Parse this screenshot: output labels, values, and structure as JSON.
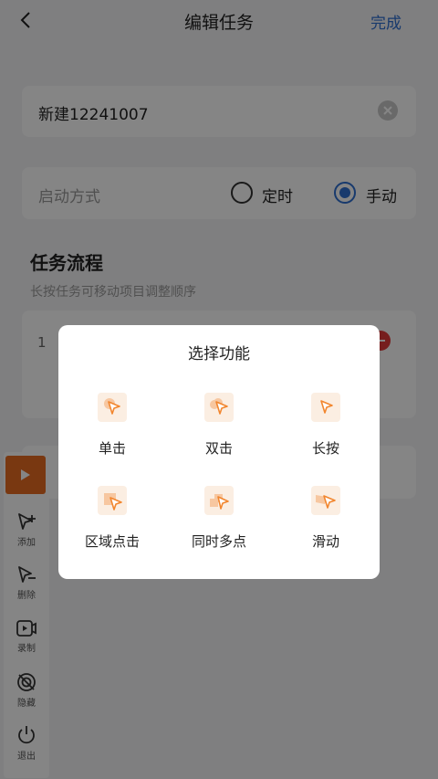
{
  "header": {
    "title": "编辑任务",
    "done_label": "完成"
  },
  "task_name": {
    "value": "新建12241007"
  },
  "start_mode": {
    "label": "启动方式",
    "options": [
      {
        "label": "定时",
        "selected": false
      },
      {
        "label": "手动",
        "selected": true
      }
    ]
  },
  "flow": {
    "title": "任务流程",
    "hint": "长按任务可移动项目调整顺序",
    "items": [
      {
        "index": "1"
      }
    ]
  },
  "toolbar": {
    "items": [
      {
        "label": "添加",
        "icon": "cursor-plus-icon"
      },
      {
        "label": "删除",
        "icon": "cursor-minus-icon"
      },
      {
        "label": "录制",
        "icon": "video-record-icon"
      },
      {
        "label": "隐藏",
        "icon": "eye-hide-icon"
      },
      {
        "label": "退出",
        "icon": "power-icon"
      }
    ]
  },
  "dialog": {
    "title": "选择功能",
    "functions": [
      {
        "label": "单击",
        "icon": "single-tap-icon"
      },
      {
        "label": "双击",
        "icon": "double-tap-icon"
      },
      {
        "label": "长按",
        "icon": "long-press-icon"
      },
      {
        "label": "区域点击",
        "icon": "area-tap-icon"
      },
      {
        "label": "同时多点",
        "icon": "multi-tap-icon"
      },
      {
        "label": "滑动",
        "icon": "swipe-icon"
      }
    ]
  },
  "colors": {
    "accent": "#2f6fd1",
    "play": "#e86b21",
    "icon_orange": "#f2862e",
    "icon_bg": "#fbeee2"
  }
}
